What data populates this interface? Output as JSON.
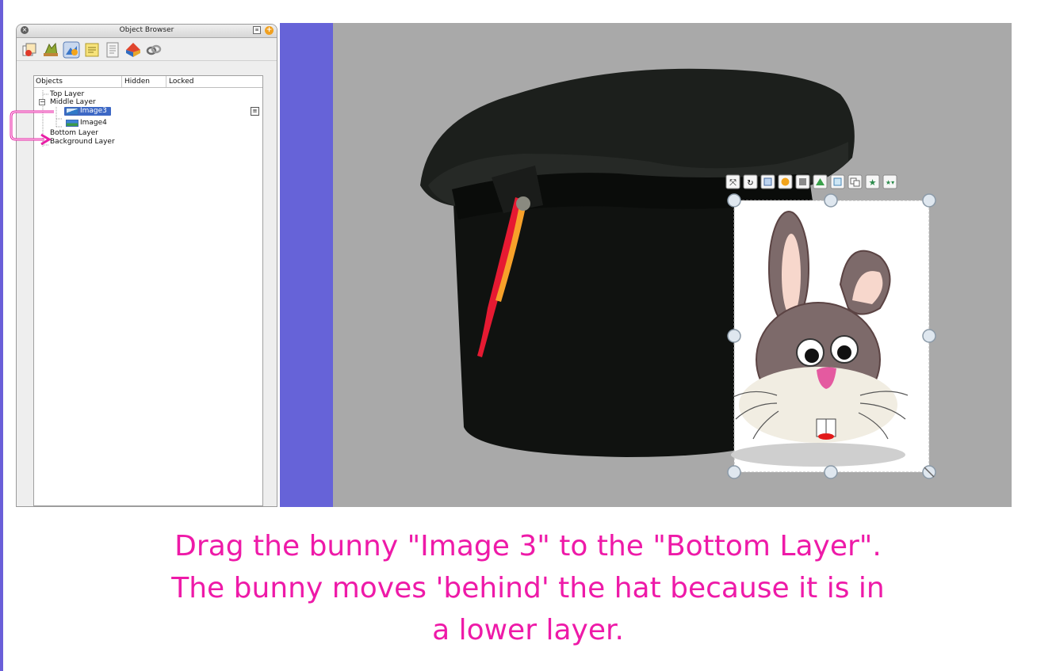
{
  "panel": {
    "title": "Object Browser",
    "close_glyph": "×",
    "menu_glyph": "≡",
    "add_glyph": "+",
    "tools": [
      "page-sorter-icon",
      "gallery-icon",
      "object-browser-icon",
      "notes-icon",
      "properties-icon",
      "action-browser-icon",
      "links-icon"
    ],
    "columns": [
      "Objects",
      "Hidden",
      "Locked"
    ],
    "tree": {
      "top_layer": "Top Layer",
      "middle_layer": "Middle Layer",
      "expander": "−",
      "image3": "Image3",
      "image4": "Image4",
      "bottom_layer": "Bottom Layer",
      "background_layer": "Background Layer",
      "row_menu": "≡"
    }
  },
  "selection_handles": 8,
  "colors": {
    "canvas": "#a9a9a9",
    "accent_purple": "#6663d8",
    "caption": "#ee1aa8",
    "selection": "#3d68c5",
    "drag_arrow": "#e81ea6"
  },
  "caption": {
    "line1": "Drag the bunny \"Image 3\" to the \"Bottom Layer\".",
    "line2": "The bunny moves 'behind' the hat because it is in",
    "line3": "a lower layer."
  }
}
